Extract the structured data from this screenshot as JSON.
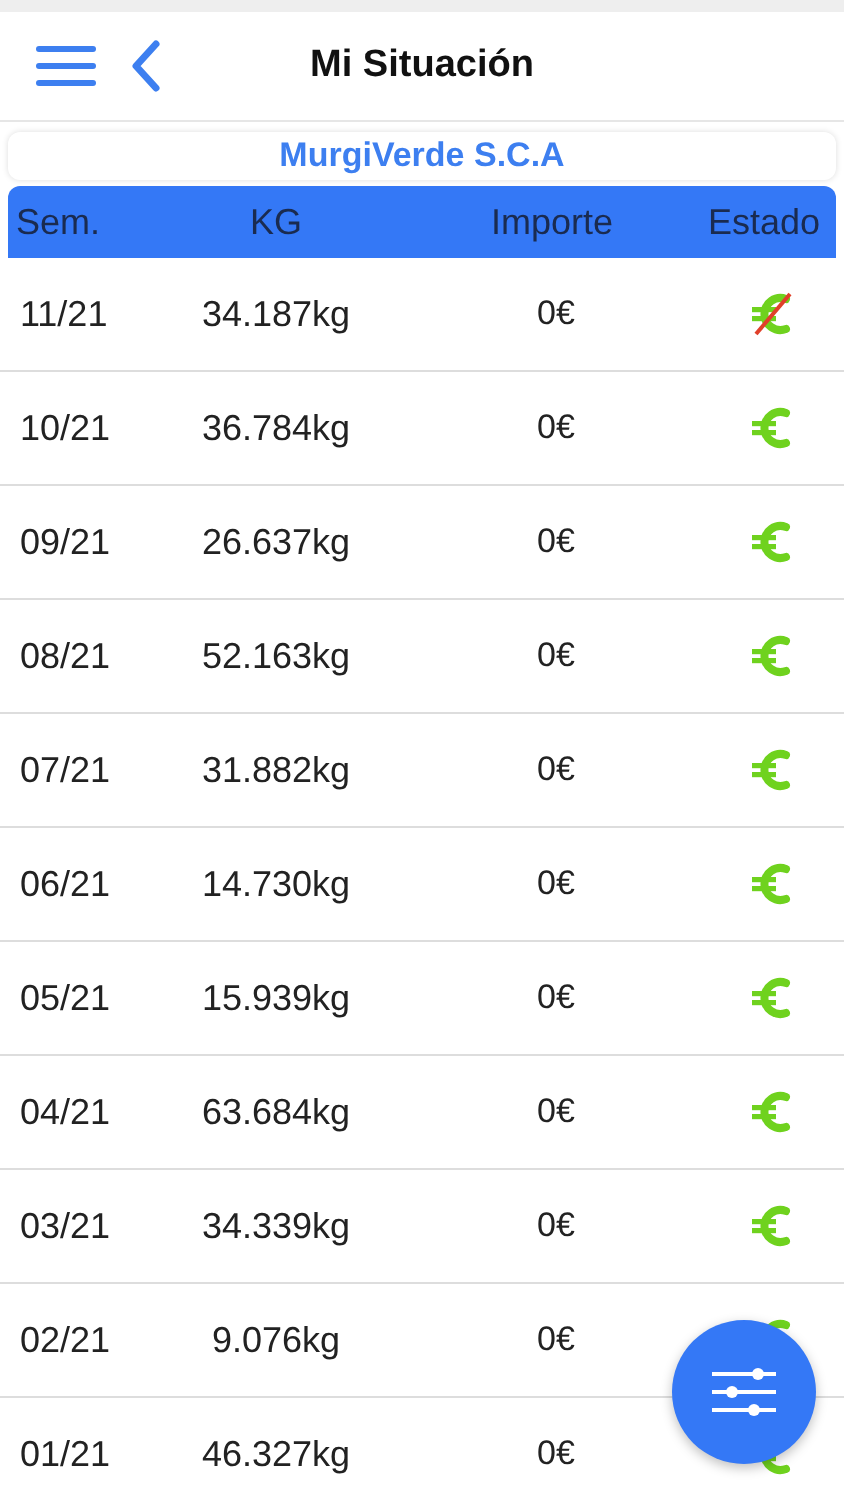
{
  "header": {
    "title": "Mi Situación"
  },
  "company": "MurgiVerde S.C.A",
  "table": {
    "columns": [
      "Sem.",
      "KG",
      "Importe",
      "Estado"
    ],
    "rows": [
      {
        "week": "11/21",
        "kg": "34.187kg",
        "amount": "0€",
        "paid": false
      },
      {
        "week": "10/21",
        "kg": "36.784kg",
        "amount": "0€",
        "paid": true
      },
      {
        "week": "09/21",
        "kg": "26.637kg",
        "amount": "0€",
        "paid": true
      },
      {
        "week": "08/21",
        "kg": "52.163kg",
        "amount": "0€",
        "paid": true
      },
      {
        "week": "07/21",
        "kg": "31.882kg",
        "amount": "0€",
        "paid": true
      },
      {
        "week": "06/21",
        "kg": "14.730kg",
        "amount": "0€",
        "paid": true
      },
      {
        "week": "05/21",
        "kg": "15.939kg",
        "amount": "0€",
        "paid": true
      },
      {
        "week": "04/21",
        "kg": "63.684kg",
        "amount": "0€",
        "paid": true
      },
      {
        "week": "03/21",
        "kg": "34.339kg",
        "amount": "0€",
        "paid": true
      },
      {
        "week": "02/21",
        "kg": "9.076kg",
        "amount": "0€",
        "paid": true
      },
      {
        "week": "01/21",
        "kg": "46.327kg",
        "amount": "0€",
        "paid": true
      }
    ]
  }
}
